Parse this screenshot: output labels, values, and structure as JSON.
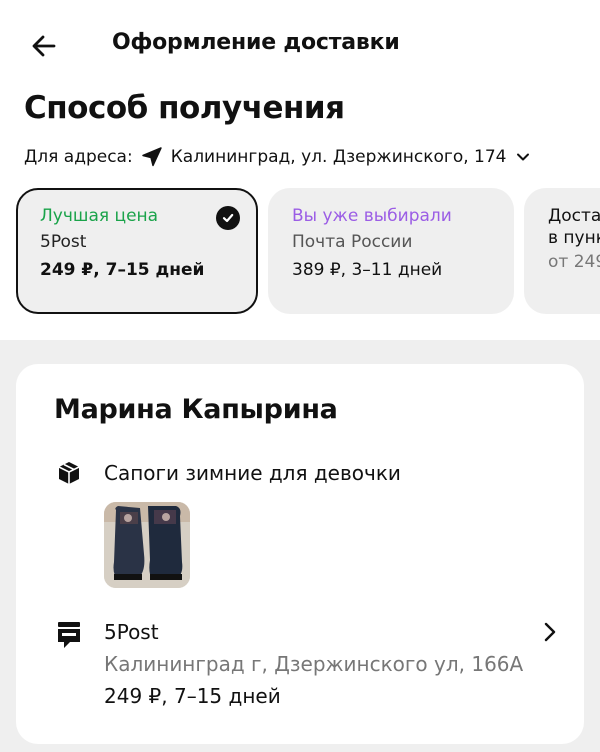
{
  "header": {
    "title": "Оформление доставки",
    "back_icon": "arrow-left-icon"
  },
  "section": {
    "title": "Способ получения"
  },
  "address": {
    "label": "Для адреса:",
    "value": "Калининград, ул. Дзержинского, 174"
  },
  "options": [
    {
      "tag": "Лучшая цена",
      "tag_color": "#1aa34a",
      "carrier": "5Post",
      "price": "249 ₽, 7–15 дней",
      "selected": true
    },
    {
      "tag": "Вы уже выбирали",
      "tag_color": "#9b5de5",
      "carrier": "Почта России",
      "price": "389 ₽, 3–11 дней",
      "selected": false
    },
    {
      "line1": "Доста",
      "line2": "в пунк",
      "price": "от 249"
    }
  ],
  "card": {
    "recipient": "Марина Капырина",
    "item_name": "Сапоги зимние для девочки",
    "delivery": {
      "name": "5Post",
      "address": "Калининград г, Дзержинского ул, 166А",
      "price": "249 ₽, 7–15 дней"
    }
  },
  "colors": {
    "accent_green": "#1aa34a",
    "accent_purple": "#9b5de5",
    "card_gray": "#efefef"
  }
}
